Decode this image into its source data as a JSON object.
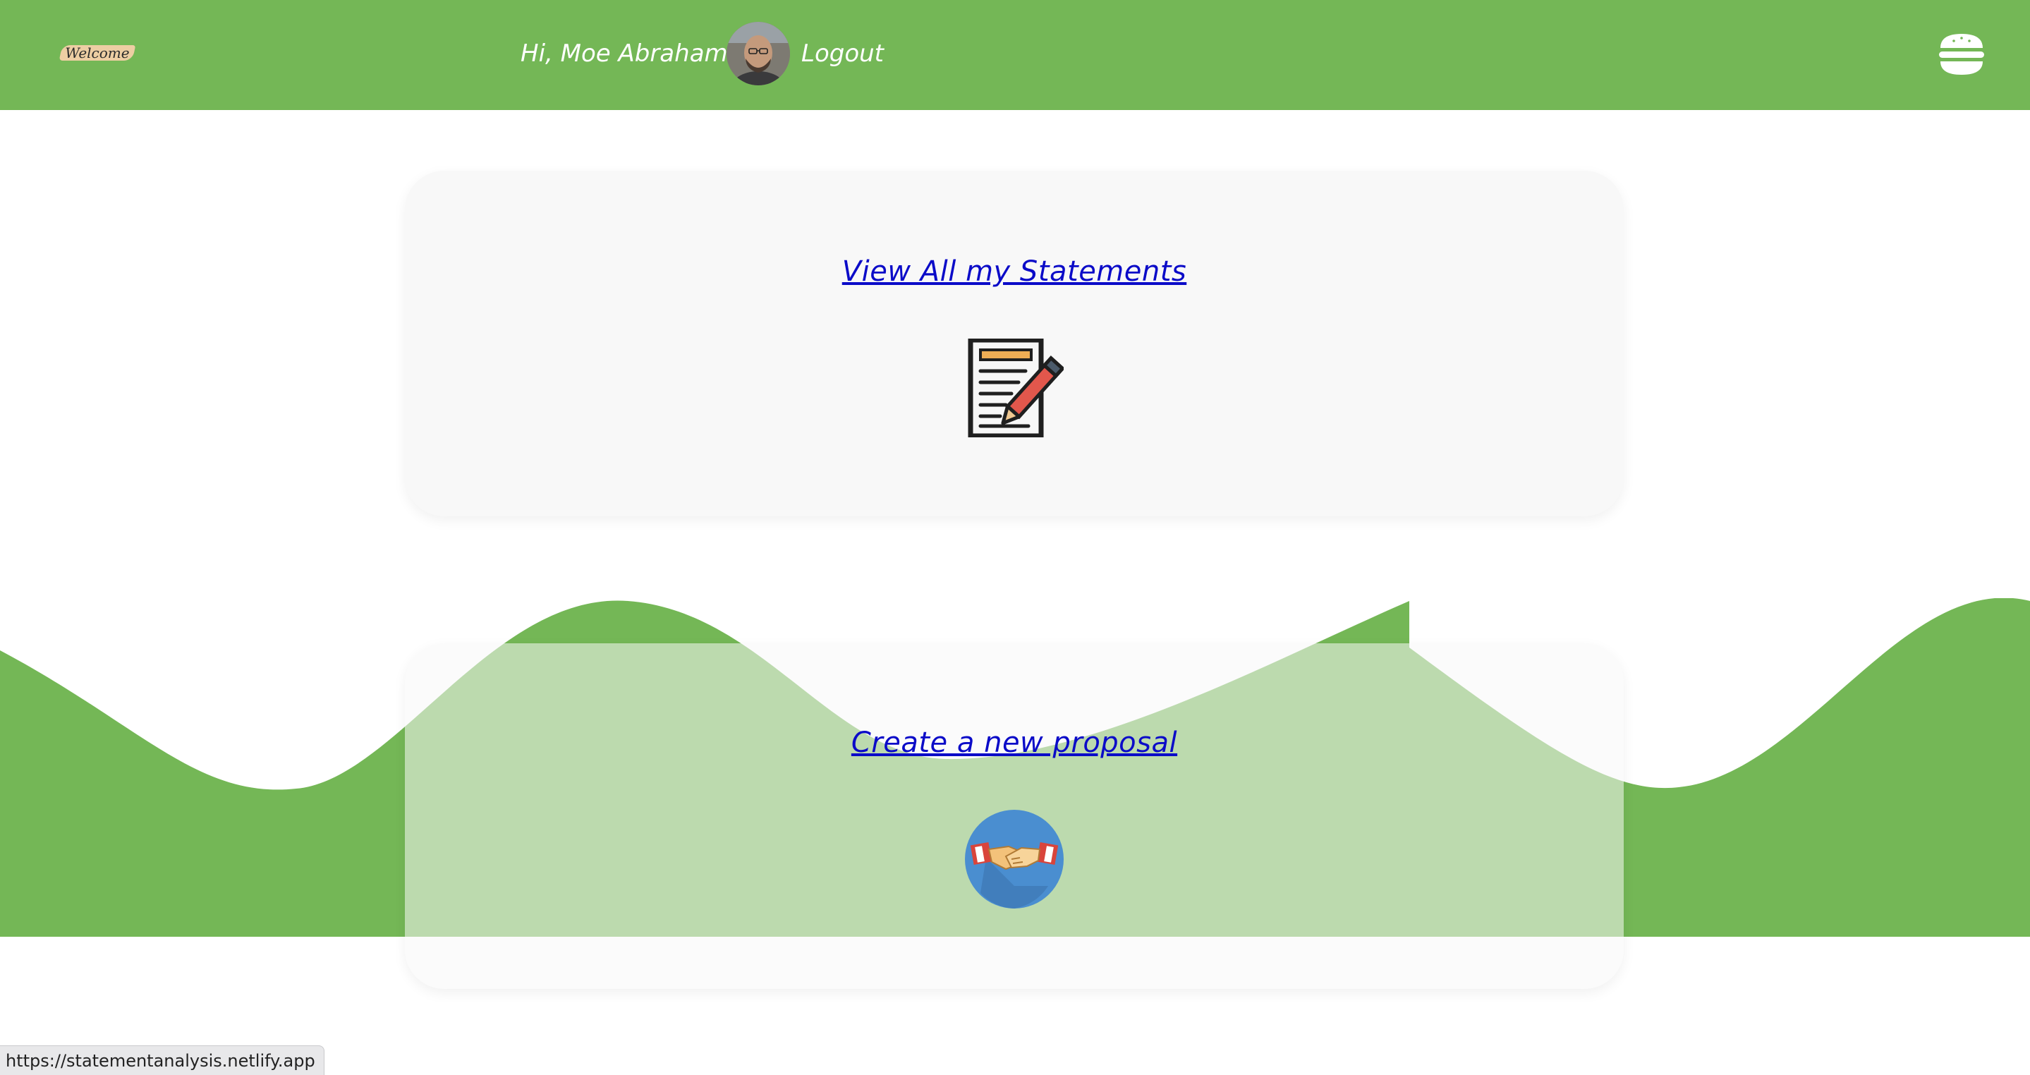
{
  "header": {
    "logo_text": "Welcome",
    "greeting": "Hi, Moe Abraham",
    "logout_label": "Logout",
    "menu_icon": "hamburger-icon",
    "background_color": "#74b756"
  },
  "cards": {
    "statements": {
      "link_label": "View All my Statements",
      "icon": "document-pencil-icon"
    },
    "proposal": {
      "link_label": "Create a new proposal",
      "icon": "handshake-icon"
    }
  },
  "status_bar": {
    "url": "https://statementanalysis.netlify.app"
  },
  "colors": {
    "accent_green": "#74b756",
    "link_blue": "#0b0bc8",
    "card_bg": "#f8f8f8"
  }
}
